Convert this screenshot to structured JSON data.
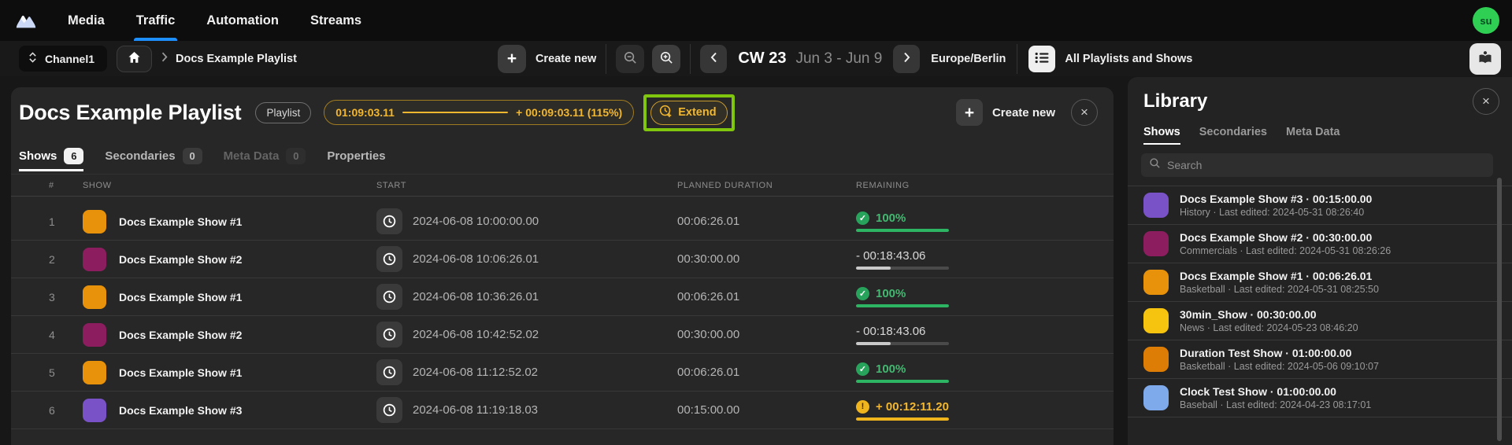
{
  "nav": {
    "items": [
      {
        "label": "Media",
        "active": false
      },
      {
        "label": "Traffic",
        "active": true
      },
      {
        "label": "Automation",
        "active": false
      },
      {
        "label": "Streams",
        "active": false
      }
    ],
    "avatar": "su"
  },
  "toolbar": {
    "channel": "Channel1",
    "breadcrumb": "Docs Example Playlist",
    "create_new": "Create new",
    "week_label": "CW 23",
    "week_range": "Jun 3 - Jun 9",
    "timezone": "Europe/Berlin",
    "all_playlists_label": "All Playlists and Shows"
  },
  "playlist": {
    "title": "Docs Example Playlist",
    "type_badge": "Playlist",
    "duration": "01:09:03.11",
    "overrun": "+ 00:09:03.11 (115%)",
    "extend_label": "Extend",
    "create_new": "Create new",
    "tabs": [
      {
        "label": "Shows",
        "count": "6",
        "state": "active"
      },
      {
        "label": "Secondaries",
        "count": "0",
        "state": ""
      },
      {
        "label": "Meta Data",
        "count": "0",
        "state": "disabled"
      },
      {
        "label": "Properties",
        "state": ""
      }
    ]
  },
  "table": {
    "columns": [
      "#",
      "SHOW",
      "START",
      "PLANNED DURATION",
      "REMAINING"
    ],
    "rows": [
      {
        "num": "1",
        "show": "Docs Example Show #1",
        "color": "#e8920b",
        "start": "2024-06-08 10:00:00.00",
        "planned": "00:06:26.01",
        "remaining": {
          "state": "complete",
          "label": "100%",
          "progress": 100
        }
      },
      {
        "num": "2",
        "show": "Docs Example Show #2",
        "color": "#8c1d5f",
        "start": "2024-06-08 10:06:26.01",
        "planned": "00:30:00.00",
        "remaining": {
          "state": "under",
          "label": "- 00:18:43.06",
          "progress": 37
        }
      },
      {
        "num": "3",
        "show": "Docs Example Show #1",
        "color": "#e8920b",
        "start": "2024-06-08 10:36:26.01",
        "planned": "00:06:26.01",
        "remaining": {
          "state": "complete",
          "label": "100%",
          "progress": 100
        }
      },
      {
        "num": "4",
        "show": "Docs Example Show #2",
        "color": "#8c1d5f",
        "start": "2024-06-08 10:42:52.02",
        "planned": "00:30:00.00",
        "remaining": {
          "state": "under",
          "label": "- 00:18:43.06",
          "progress": 37
        }
      },
      {
        "num": "5",
        "show": "Docs Example Show #1",
        "color": "#e8920b",
        "start": "2024-06-08 11:12:52.02",
        "planned": "00:06:26.01",
        "remaining": {
          "state": "complete",
          "label": "100%",
          "progress": 100
        }
      },
      {
        "num": "6",
        "show": "Docs Example Show #3",
        "color": "#7a52c8",
        "start": "2024-06-08 11:19:18.03",
        "planned": "00:15:00.00",
        "remaining": {
          "state": "over",
          "label": "+ 00:12:11.20",
          "progress": 100
        }
      }
    ]
  },
  "library": {
    "title": "Library",
    "tabs": [
      {
        "label": "Shows",
        "active": true
      },
      {
        "label": "Secondaries",
        "active": false
      },
      {
        "label": "Meta Data",
        "active": false
      }
    ],
    "search_placeholder": "Search",
    "items": [
      {
        "color": "#7a52c8",
        "title": "Docs Example Show #3 · 00:15:00.00",
        "subtitle": "History · Last edited: 2024-05-31 08:26:40"
      },
      {
        "color": "#8c1d5f",
        "title": "Docs Example Show #2 · 00:30:00.00",
        "subtitle": "Commercials · Last edited: 2024-05-31 08:26:26"
      },
      {
        "color": "#e8920b",
        "title": "Docs Example Show #1 · 00:06:26.01",
        "subtitle": "Basketball · Last edited: 2024-05-31 08:25:50"
      },
      {
        "color": "#f6c40f",
        "title": "30min_Show · 00:30:00.00",
        "subtitle": "News · Last edited: 2024-05-23 08:46:20"
      },
      {
        "color": "#dd7d05",
        "title": "Duration Test Show · 01:00:00.00",
        "subtitle": "Basketball · Last edited: 2024-05-06 09:10:07"
      },
      {
        "color": "#7ea9ea",
        "title": "Clock Test Show · 01:00:00.00",
        "subtitle": "Baseball · Last edited: 2024-04-23 08:17:01"
      }
    ]
  },
  "icons": {
    "plus": "+",
    "close": "×",
    "check": "✓",
    "warning": "!"
  },
  "colors": {
    "accent_blue": "#1e8fff",
    "amber": "#f3b72f",
    "green_ok": "#2db563",
    "warning_amber": "#f0b41c",
    "highlight_green": "#80c50e",
    "avatar_green": "#2fcf54"
  }
}
